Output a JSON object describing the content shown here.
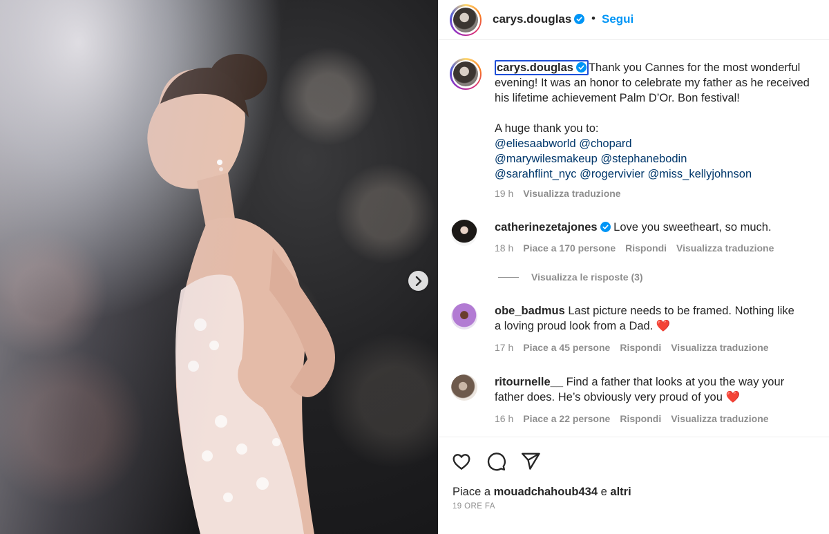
{
  "post": {
    "username": "carys.douglas",
    "follow_label": "Segui",
    "separator": "•",
    "caption_lines": [
      "Thank you Cannes for the most wonderful",
      "evening! It was an honor to celebrate my father as he received",
      "his lifetime achievement Palm D’Or. Bon festival!"
    ],
    "thanks_line": "A huge thank you to:",
    "tags_lines": [
      "@eliesaabworld @chopard",
      "@marywilesmakeup @stephanebodin",
      "@sarahflint_nyc @rogervivier @miss_kellyjohnson"
    ],
    "time": "19 h",
    "translate": "Visualizza traduzione"
  },
  "comments": [
    {
      "username": "catherinezetajones",
      "verified": true,
      "text": "Love you sweetheart, so much.",
      "time": "18 h",
      "likes": "Piace a 170 persone",
      "reply": "Rispondi",
      "translate": "Visualizza traduzione",
      "view_replies": "Visualizza le risposte (3)"
    },
    {
      "username": "obe_badmus",
      "text_line1": "Last picture needs to be framed. Nothing like",
      "text_line2": "a loving proud look from a Dad.",
      "emoji": "❤️",
      "time": "17 h",
      "likes": "Piace a 45 persone",
      "reply": "Rispondi",
      "translate": "Visualizza traduzione"
    },
    {
      "username": "ritournelle__",
      "text_line1": "Find a father that looks at you the way your",
      "text_line2": "father does. He’s obviously very proud of you",
      "emoji": "❤️",
      "time": "16 h",
      "likes": "Piace a 22 persone",
      "reply": "Rispondi",
      "translate": "Visualizza traduzione"
    }
  ],
  "footer": {
    "likes_prefix": "Piace a",
    "likes_user": "mouadchahoub434",
    "likes_conj": "e",
    "likes_others": "altri",
    "date": "19 ORE FA"
  },
  "icons": [
    "chevron-right-icon",
    "verified-badge-icon",
    "heart-icon",
    "comment-icon",
    "share-icon"
  ],
  "colors": {
    "link": "#00376b",
    "follow": "#0095f6",
    "verified": "#0095f6",
    "muted": "#8e8e8e"
  }
}
